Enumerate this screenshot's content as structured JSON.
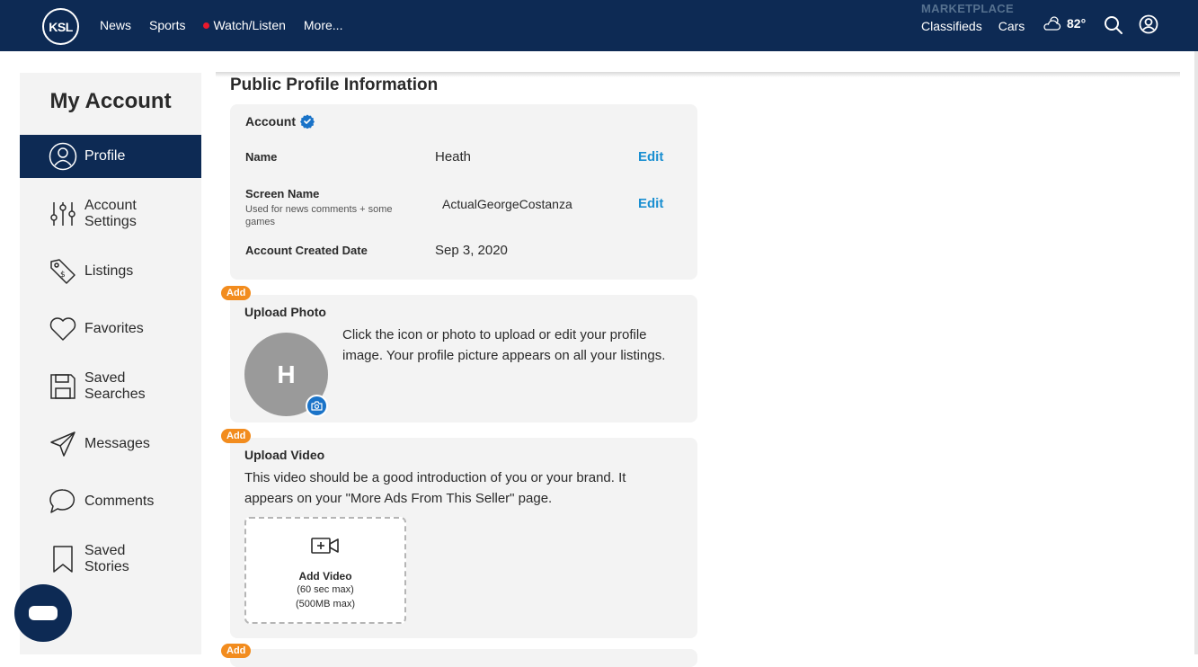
{
  "header": {
    "logo": "KSL",
    "nav": [
      "News",
      "Sports",
      "Watch/Listen",
      "More..."
    ],
    "marketplace_label": "MARKETPLACE",
    "marketplace_links": [
      "Classifieds",
      "Cars"
    ],
    "weather_temp": "82°",
    "weather_icon": "partly-cloudy-icon",
    "colors": {
      "bar": "#0d2a54",
      "live_dot": "#e8192c"
    }
  },
  "sidebar": {
    "title": "My Account",
    "items": [
      {
        "label": "Profile",
        "icon": "user-circle-icon",
        "active": true
      },
      {
        "label": "Account Settings",
        "icon": "sliders-icon",
        "active": false
      },
      {
        "label": "Listings",
        "icon": "tag-icon",
        "active": false
      },
      {
        "label": "Favorites",
        "icon": "heart-icon",
        "active": false
      },
      {
        "label": "Saved Searches",
        "icon": "floppy-disk-icon",
        "active": false
      },
      {
        "label": "Messages",
        "icon": "paper-plane-icon",
        "active": false
      },
      {
        "label": "Comments",
        "icon": "speech-bubble-icon",
        "active": false
      },
      {
        "label": "Saved Stories",
        "icon": "bookmark-icon",
        "active": false
      }
    ]
  },
  "main": {
    "title": "Public Profile Information",
    "account": {
      "heading": "Account",
      "name_label": "Name",
      "name_value": "Heath",
      "screen_name_label": "Screen Name",
      "screen_name_hint": "Used for news comments + some games",
      "screen_name_value": "ActualGeorgeCostanza",
      "created_label": "Account Created Date",
      "created_value": "Sep 3, 2020",
      "edit_label": "Edit"
    },
    "upload_photo": {
      "badge": "Add",
      "title": "Upload Photo",
      "avatar_initial": "H",
      "description": "Click the icon or photo to upload or edit your profile image. Your profile picture appears on all your listings."
    },
    "upload_video": {
      "badge": "Add",
      "title": "Upload Video",
      "description": "This video should be a good introduction of you or your brand. It appears on your \"More Ads From This Seller\" page.",
      "button_label": "Add Video",
      "limit_time": "(60 sec max)",
      "limit_size": "(500MB max)"
    },
    "next_badge": "Add",
    "colors": {
      "accent_link": "#1a8fd1",
      "badge": "#f28c1e",
      "card_bg": "#f3f3f3"
    }
  }
}
